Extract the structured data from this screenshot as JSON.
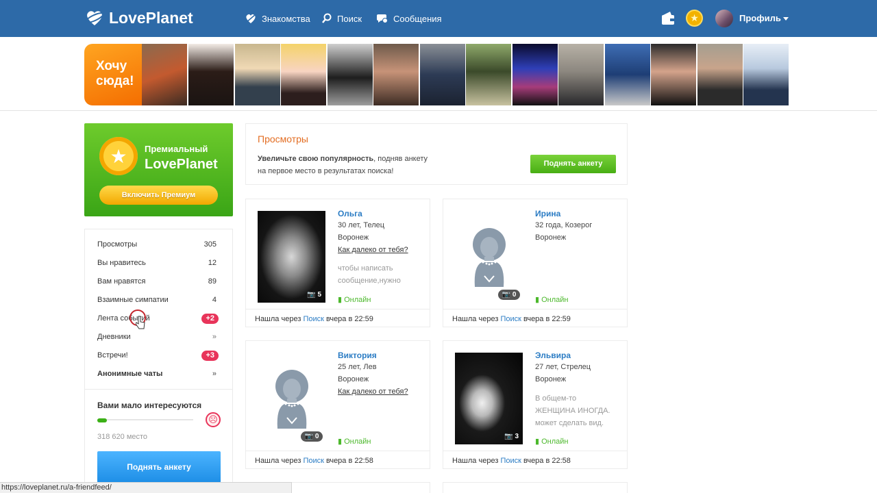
{
  "header": {
    "logo_text": "LovePlanet",
    "nav": [
      "Знакомства",
      "Поиск",
      "Сообщения"
    ],
    "profile_label": "Профиль"
  },
  "strip": {
    "promo_line1": "Хочу",
    "promo_line2": "сюда!"
  },
  "premium": {
    "title_small": "Премиальный",
    "title_big": "LovePlanet",
    "button": "Включить Премиум"
  },
  "sidebar": {
    "items": [
      {
        "label": "Просмотры",
        "count": "305"
      },
      {
        "label": "Вы нравитесь",
        "count": "12"
      },
      {
        "label": "Вам нравятся",
        "count": "89"
      },
      {
        "label": "Взаимные симпатии",
        "count": "4"
      },
      {
        "label": "Лента событий",
        "badge": "+2"
      },
      {
        "label": "Дневники",
        "arrow": "»"
      },
      {
        "label": "Встречи!",
        "badge": "+3"
      },
      {
        "label": "Анонимные чаты",
        "arrow": "»"
      }
    ],
    "interest_title": "Вами мало интересуются",
    "interest_progress": 0.1,
    "place_text": "318 620 место",
    "raise_button": "Поднять анкету"
  },
  "views": {
    "title": "Просмотры",
    "text_bold": "Увеличьте свою популярность",
    "text_rest1": ", подняв анкету",
    "text_rest2": "на первое место в результатах поиска!",
    "button": "Поднять анкету"
  },
  "cards": [
    {
      "name": "Ольга",
      "line1": "30 лет, Телец",
      "city": "Воронеж",
      "distance": "Как далеко от тебя?",
      "note": "чтобы написать сообщение,нужно",
      "photos": "5",
      "online": "Онлайн",
      "found_prefix": "Нашла через",
      "found_link": "Поиск",
      "found_time": "вчера в 22:59"
    },
    {
      "name": "Ирина",
      "line1": "32 года, Козерог",
      "city": "Воронеж",
      "photos": "0",
      "online": "Онлайн",
      "found_prefix": "Нашла через",
      "found_link": "Поиск",
      "found_time": "вчера в 22:59"
    },
    {
      "name": "Виктория",
      "line1": "25 лет, Лев",
      "city": "Воронеж",
      "distance": "Как далеко от тебя?",
      "photos": "0",
      "online": "Онлайн",
      "found_prefix": "Нашла через",
      "found_link": "Поиск",
      "found_time": "вчера в 22:58"
    },
    {
      "name": "Эльвира",
      "line1": "27 лет, Стрелец",
      "city": "Воронеж",
      "note": "В общем-то ЖЕНЩИНА ИНОГДА. может сделать вид.",
      "photos": "3",
      "online": "Онлайн",
      "found_prefix": "Нашла через",
      "found_link": "Поиск",
      "found_time": "вчера в 22:58"
    }
  ],
  "status_url": "https://loveplanet.ru/a-friendfeed/",
  "colors": {
    "header": "#2d6aa8",
    "accent_green": "#48ae14",
    "link_blue": "#2b7cc4",
    "badge_red": "#e8345a",
    "orange": "#e36d22"
  }
}
